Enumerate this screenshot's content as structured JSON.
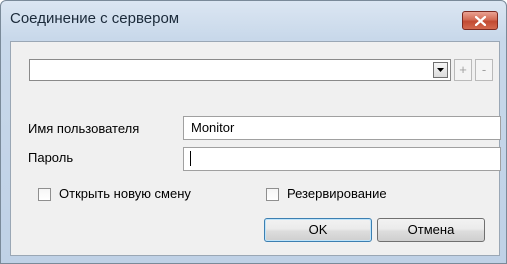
{
  "window": {
    "title": "Соединение с сервером",
    "close_icon": "close-icon"
  },
  "server": {
    "combo_value": "",
    "add_label": "+",
    "remove_label": "-"
  },
  "login": {
    "username_label": "Имя пользователя",
    "username_value": "Monitor",
    "password_label": "Пароль",
    "password_value": ""
  },
  "options": {
    "open_new_shift_label": "Открыть новую смену",
    "open_new_shift_checked": false,
    "reservation_label": "Резервирование",
    "reservation_checked": false
  },
  "buttons": {
    "ok_label": "OK",
    "cancel_label": "Отмена"
  },
  "colors": {
    "title_bar": "#c8d8ea",
    "close_button": "#c24a32",
    "client_background": "#f0f0f0"
  }
}
